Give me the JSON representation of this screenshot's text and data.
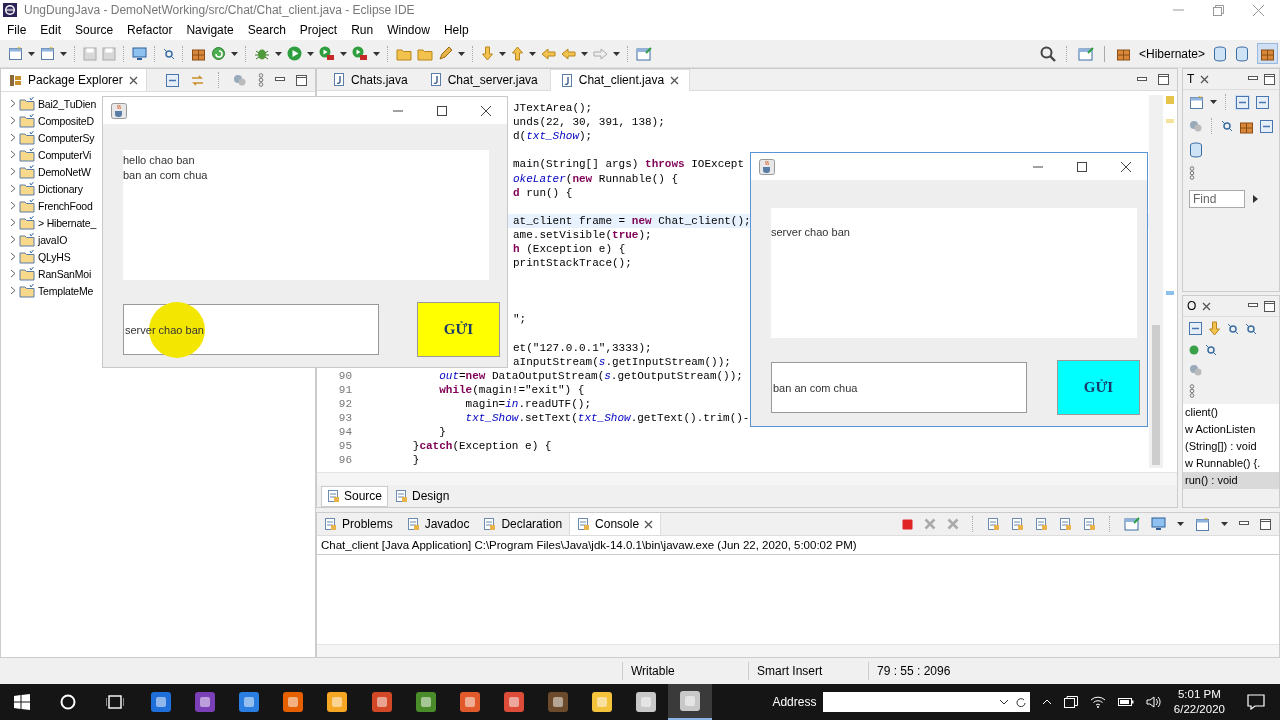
{
  "window": {
    "title": "UngDungJava - DemoNetWorking/src/Chat/Chat_client.java - Eclipse IDE"
  },
  "menu": [
    "File",
    "Edit",
    "Source",
    "Refactor",
    "Navigate",
    "Search",
    "Project",
    "Run",
    "Window",
    "Help"
  ],
  "toolbar": {
    "perspective": "<Hibernate>"
  },
  "package_explorer": {
    "title": "Package Explorer",
    "projects": [
      {
        "name": "Bai2_TuDien"
      },
      {
        "name": "CompositeD"
      },
      {
        "name": "ComputerSy"
      },
      {
        "name": "ComputerVi"
      },
      {
        "name": "DemoNetW"
      },
      {
        "name": "Dictionary"
      },
      {
        "name": "FrenchFood"
      },
      {
        "name": "> Hibernate_"
      },
      {
        "name": "javaIO"
      },
      {
        "name": "QLyHS"
      },
      {
        "name": "RanSanMoi"
      },
      {
        "name": "TemplateMe"
      }
    ]
  },
  "editor": {
    "tabs": [
      {
        "label": "Chats.java",
        "selected": false
      },
      {
        "label": "Chat_server.java",
        "selected": false
      },
      {
        "label": "Chat_client.java",
        "selected": true
      }
    ],
    "lines": [
      {
        "kind": "partial",
        "text": "JTextArea();",
        "current": false
      },
      {
        "kind": "partial",
        "text": "unds(22, 30, 391, 138);",
        "current": false
      },
      {
        "kind": "partial",
        "text": "d(*txt_Show*);",
        "current": false
      },
      {
        "kind": "blank",
        "current": false
      },
      {
        "kind": "partial",
        "text": "main(String[] args) **throws** IOExcept",
        "current": false
      },
      {
        "kind": "partial",
        "text": "*okeLater*(**new** Runnable() {",
        "current": false
      },
      {
        "kind": "partial",
        "text": "**d** run() {",
        "current": false
      },
      {
        "kind": "blank",
        "current": false
      },
      {
        "kind": "partial",
        "text": "at_client frame = **new** Chat_client();",
        "current": true
      },
      {
        "kind": "partial",
        "text": "ame.setVisible(**true**);",
        "current": false
      },
      {
        "kind": "partial",
        "text": "**h** (Exception e) {",
        "current": false
      },
      {
        "kind": "partial",
        "text": "printStackTrace();",
        "current": false
      },
      {
        "kind": "blank",
        "current": false
      },
      {
        "kind": "blank",
        "current": false
      },
      {
        "kind": "blank",
        "current": false
      },
      {
        "kind": "partial",
        "text": "\";",
        "current": false
      },
      {
        "kind": "blank",
        "current": false
      },
      {
        "kind": "partial",
        "text": "et(\"127.0.0.1\",3333);",
        "current": false
      },
      {
        "kind": "partial",
        "text": "aInputStream(*s*.getInputStream());",
        "current": false
      },
      {
        "kind": "full",
        "number": "90",
        "text": "            *out*=**new** DataOutputStream(*s*.getOutputStream());",
        "current": false
      },
      {
        "kind": "full",
        "number": "91",
        "text": "            **while**(magin!=\"exit\") {",
        "current": false
      },
      {
        "kind": "full",
        "number": "92",
        "text": "                magin=*in*.readUTF();",
        "current": false
      },
      {
        "kind": "full",
        "number": "93",
        "text": "                *txt_Show*.setText(*txt_Show*.getText().trim()-",
        "current": false
      },
      {
        "kind": "full",
        "number": "94",
        "text": "            }",
        "current": false
      },
      {
        "kind": "full",
        "number": "95",
        "text": "        }**catch**(Exception e) {",
        "current": false
      },
      {
        "kind": "full",
        "number": "96",
        "text": "        }",
        "current": false
      }
    ],
    "bottom_tabs": [
      {
        "label": "Source",
        "selected": true
      },
      {
        "label": "Design",
        "selected": false
      }
    ]
  },
  "type_panel": {
    "title": "T",
    "find": {
      "placeholder": "Find"
    }
  },
  "outline": {
    "title": "O",
    "items": [
      {
        "label": "client()",
        "selected": false
      },
      {
        "label": "w ActionListen",
        "selected": false
      },
      {
        "label": "(String[]) : void",
        "selected": false
      },
      {
        "label": "w Runnable() {.",
        "selected": false
      },
      {
        "label": "run() : void",
        "selected": true
      }
    ]
  },
  "console": {
    "tabs": [
      {
        "label": "Problems",
        "selected": false
      },
      {
        "label": "Javadoc",
        "selected": false
      },
      {
        "label": "Declaration",
        "selected": false
      },
      {
        "label": "Console",
        "selected": true
      }
    ],
    "header": "Chat_client [Java Application] C:\\Program Files\\Java\\jdk-14.0.1\\bin\\javaw.exe  (Jun 22, 2020, 5:00:02 PM)"
  },
  "status_bar": {
    "mode": "Writable",
    "insert": "Smart Insert",
    "position": "79 : 55 : 2096"
  },
  "chat_windows": [
    {
      "messages": [
        "hello chao ban",
        "ban an com chua"
      ],
      "input": "server chao ban",
      "button": "GỬI",
      "color": "#ffff00"
    },
    {
      "messages": [
        "server chao ban"
      ],
      "input": "ban an com chua",
      "button": "GỬI",
      "color": "#00ffff"
    }
  ],
  "taskbar": {
    "address_label": "Address",
    "time": "5:01 PM",
    "date": "6/22/2020"
  }
}
